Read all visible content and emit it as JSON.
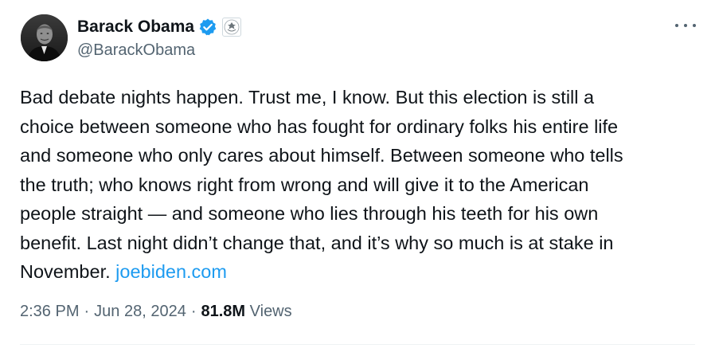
{
  "author": {
    "display_name": "Barack Obama",
    "handle": "@BarackObama",
    "verified_color": "#1d9bf0",
    "affiliation_icon": "seal-icon"
  },
  "tweet": {
    "lines": [
      "Bad debate nights happen. Trust me, I know. But this election is still a",
      "choice between someone who has fought for ordinary folks his entire life",
      "and someone who only cares about himself. Between someone who tells",
      "the truth; who knows right from wrong and will give it to the American",
      "people straight — and someone who lies through his teeth for his own",
      "benefit. Last night didn’t change that, and it’s why so much is at stake in",
      "November."
    ],
    "link_text": "joebiden.com"
  },
  "meta": {
    "time": "2:36 PM",
    "dot": "·",
    "date": "Jun 28, 2024",
    "views_count": "81.8M",
    "views_label": "Views"
  },
  "colors": {
    "text": "#0f1419",
    "secondary": "#536471",
    "link": "#1d9bf0"
  }
}
